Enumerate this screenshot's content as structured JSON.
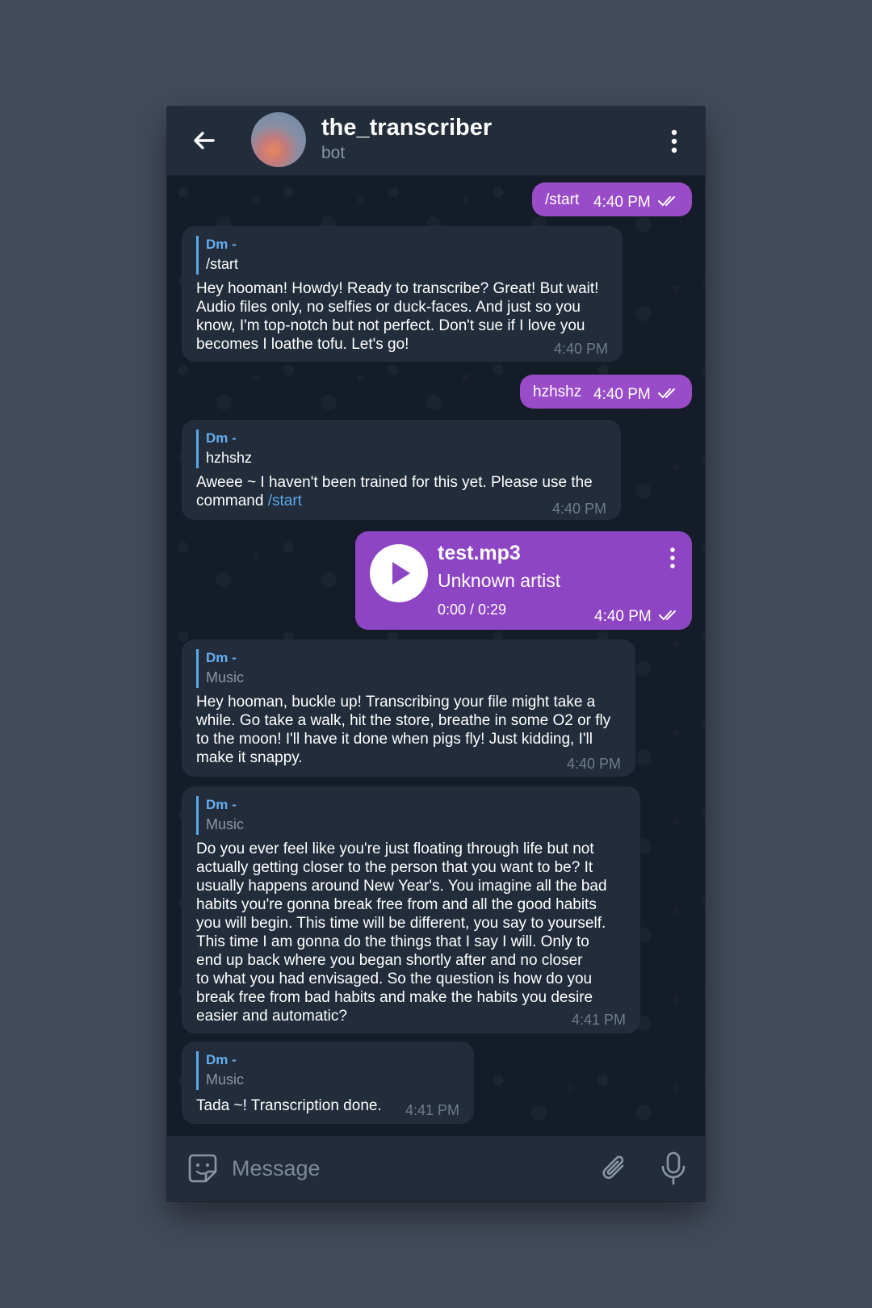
{
  "header": {
    "title": "the_transcriber",
    "subtitle": "bot",
    "back_icon": "arrow-left-icon",
    "more_icon": "more-vertical-icon"
  },
  "messages": [
    {
      "type": "out",
      "text": "/start",
      "time": "4:40 PM",
      "status": "read"
    },
    {
      "type": "in",
      "reply_name": "Dm -",
      "reply_text": "/start",
      "text": "Hey hooman! Howdy! Ready to transcribe? Great! But wait!\nAudio files only, no selfies or duck-faces. And just so you\nknow, I'm top-notch but not perfect. Don't sue if I love you\nbecomes I loathe tofu. Let's go!",
      "time": "4:40 PM"
    },
    {
      "type": "out",
      "text": "hzhshz",
      "time": "4:40 PM",
      "status": "read"
    },
    {
      "type": "in",
      "reply_name": "Dm -",
      "reply_text": "hzhshz",
      "text_before_link": "Aweee ~ I haven't been trained for this yet. Please use the\ncommand ",
      "link_text": "/start",
      "time": "4:40 PM"
    },
    {
      "type": "audio",
      "title": "test.mp3",
      "artist": "Unknown artist",
      "progress": "0:00 / 0:29",
      "time": "4:40 PM",
      "status": "read"
    },
    {
      "type": "in",
      "reply_name": "Dm -",
      "reply_text": "Music",
      "text": "Hey hooman, buckle up! Transcribing your file might take a\nwhile. Go take a walk, hit the store, breathe in some O2 or fly\nto the moon! I'll have it done when pigs fly! Just kidding, I'll\nmake it snappy.",
      "time": "4:40 PM"
    },
    {
      "type": "in",
      "reply_name": "Dm -",
      "reply_text": "Music",
      "text": "Do you ever feel like you're just floating through life but not\nactually getting closer to the person that you want to be? It\nusually happens around New Year's. You imagine all the bad\nhabits you're gonna break free from and all the good habits\nyou will begin. This time will be different, you say to yourself.\nThis time I am gonna do the things that I say I will. Only to\nend up back where you began shortly after and no closer\nto what you had envisaged. So the question is how do you\nbreak free from bad habits and make the habits you desire\neasier and automatic?",
      "time": "4:41 PM"
    },
    {
      "type": "in",
      "reply_name": "Dm -",
      "reply_text": "Music",
      "text": "Tada ~! Transcription done.",
      "time": "4:41 PM"
    }
  ],
  "input": {
    "placeholder": "Message",
    "value": "",
    "sticker_icon": "sticker-smile-icon",
    "attach_icon": "paperclip-icon",
    "mic_icon": "microphone-icon"
  },
  "colors": {
    "background": "#434b5b",
    "header": "#222c3a",
    "chat_bg": "#141c27",
    "incoming_bubble": "#222c3a",
    "outgoing_bubble": "#8e45c4",
    "accent": "#65aef0"
  }
}
